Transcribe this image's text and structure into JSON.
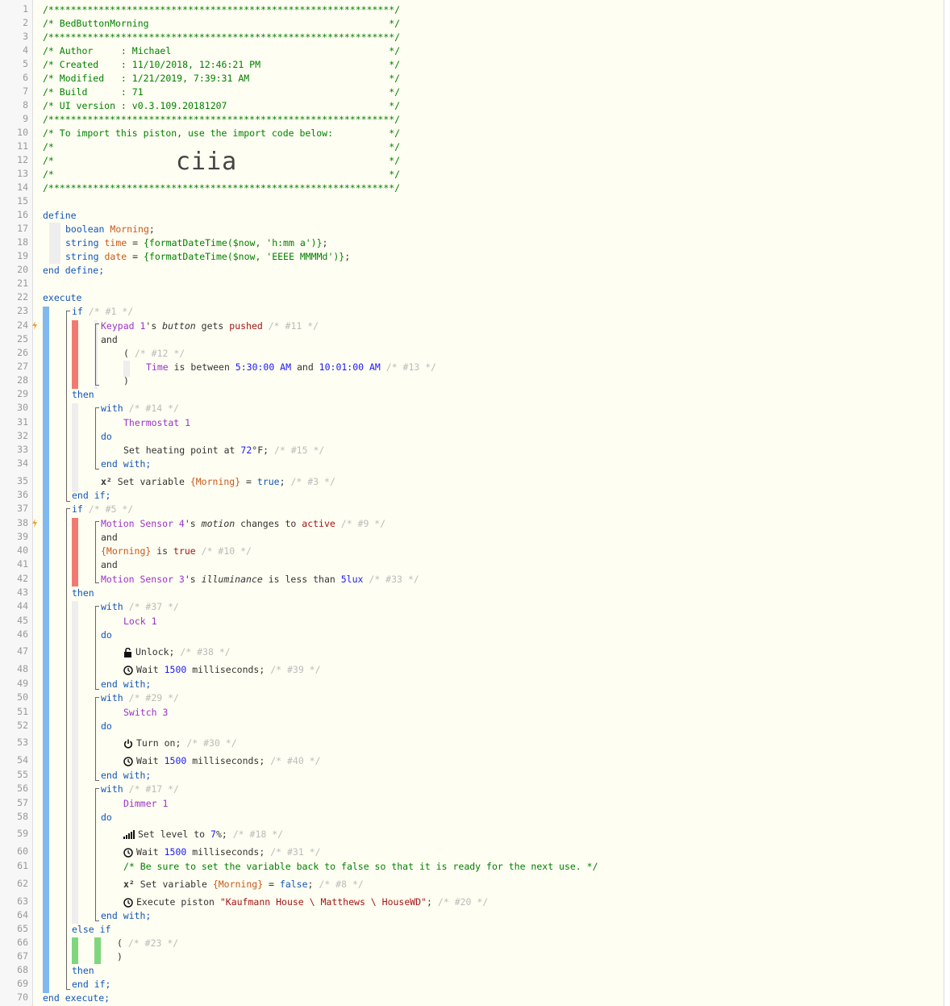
{
  "import_code": "ciia",
  "colors": {
    "gutter_bg": "#f7f7f7",
    "editor_bg": "#fffef2",
    "comment": "#008000",
    "keyword": "#1155bb",
    "variable": "#c65a1a",
    "device": "#9933cc",
    "if_condition_bar": "#f07a72",
    "else_if_condition_bar": "#7fd67f",
    "execute_bar": "#7fb9f0"
  },
  "icons": [
    "lightning-bolt-icon",
    "unlock-icon",
    "clock-icon",
    "power-icon",
    "signal-level-icon",
    "superscript-x2-icon"
  ],
  "line_numbers": [
    "1",
    "2",
    "3",
    "4",
    "5",
    "6",
    "7",
    "8",
    "9",
    "10",
    "11",
    "12",
    "13",
    "14",
    "15",
    "16",
    "17",
    "18",
    "19",
    "20",
    "21",
    "22",
    "23",
    "24",
    "25",
    "26",
    "27",
    "28",
    "29",
    "30",
    "31",
    "32",
    "33",
    "34",
    "35",
    "36",
    "37",
    "38",
    "39",
    "40",
    "41",
    "42",
    "43",
    "44",
    "45",
    "46",
    "47",
    "48",
    "49",
    "50",
    "51",
    "52",
    "53",
    "54",
    "55",
    "56",
    "57",
    "58",
    "59",
    "60",
    "61",
    "62",
    "63",
    "64",
    "65",
    "66",
    "67",
    "68",
    "69",
    "70"
  ],
  "header": [
    "/**************************************************************/",
    "/* BedButtonMorning                                           */",
    "/**************************************************************/",
    "/* Author     : Michael                                       */",
    "/* Created    : 11/10/2018, 12:46:21 PM                       */",
    "/* Modified   : 1/21/2019, 7:39:31 AM                         */",
    "/* Build      : 71                                            */",
    "/* UI version : v0.3.109.20181207                             */",
    "/**************************************************************/",
    "/* To import this piston, use the import code below:          */",
    "/*                                                            */",
    "/*                                                            */",
    "/*                                                            */",
    "/**************************************************************/"
  ],
  "define": {
    "kw": "define",
    "v1": {
      "type": "boolean",
      "name": "Morning",
      "rest": ";"
    },
    "v2": {
      "type": "string",
      "name": "time",
      "eq": " = ",
      "val": "{formatDateTime($now, 'h:mm a')}",
      "rest": ";"
    },
    "v3": {
      "type": "string",
      "name": "date",
      "eq": " = ",
      "val": "{formatDateTime($now, 'EEEE MMMMd')}",
      "rest": ";"
    },
    "end": "end define;"
  },
  "execute": {
    "kw": "execute",
    "if1": "if",
    "if1_c": "/* #1 */",
    "cond1": {
      "dev": "Keypad 1",
      "poss": "'s ",
      "attr": "button",
      "mid": " gets ",
      "val": "pushed",
      "c": "/* #11 */"
    },
    "and": "and",
    "grp": "(",
    "grp_c": "/* #12 */",
    "cond2": {
      "dev": "Time",
      "mid": " is between ",
      "t1": "5:30:00 AM",
      "and": " and ",
      "t2": "10:01:00 AM",
      "c": "/* #13 */"
    },
    "grp_close": ")",
    "then": "then",
    "with": "with",
    "with14_c": "/* #14 */",
    "thermostat": "Thermostat 1",
    "do": "do",
    "set_heat": {
      "pre": "Set heating point at ",
      "num": "72",
      "post": "°F;",
      "c": "/* #15 */"
    },
    "end_with": "end with;",
    "setvar1": {
      "pre": "Set variable ",
      "var": "{Morning}",
      "mid": " = ",
      "val": "true",
      "post": ";",
      "c": "/* #3 */"
    },
    "end_if": "end if;",
    "if5_c": "/* #5 */",
    "cond3": {
      "dev": "Motion Sensor 4",
      "poss": "'s ",
      "attr": "motion",
      "mid": " changes to ",
      "val": "active",
      "c": "/* #9 */"
    },
    "cond4": {
      "var": "{Morning}",
      "mid": " is ",
      "val": "true",
      "c": "/* #10 */"
    },
    "cond5": {
      "dev": "Motion Sensor 3",
      "poss": "'s ",
      "attr": "illuminance",
      "mid": " is less than ",
      "val": "5lux",
      "c": "/* #33 */"
    },
    "with37_c": "/* #37 */",
    "lock": "Lock 1",
    "unlock": {
      "text": "Unlock;",
      "c": "/* #38 */"
    },
    "wait39": {
      "pre": "Wait ",
      "num": "1500",
      "post": " milliseconds;",
      "c": "/* #39 */"
    },
    "with29_c": "/* #29 */",
    "switch": "Switch 3",
    "turnon": {
      "text": "Turn on;",
      "c": "/* #30 */"
    },
    "wait40": {
      "pre": "Wait ",
      "num": "1500",
      "post": " milliseconds;",
      "c": "/* #40 */"
    },
    "with17_c": "/* #17 */",
    "dimmer": "Dimmer 1",
    "setlevel": {
      "pre": "Set level to ",
      "num": "7",
      "post": "%;",
      "c": "/* #18 */"
    },
    "wait31": {
      "pre": "Wait ",
      "num": "1500",
      "post": " milliseconds;",
      "c": "/* #31 */"
    },
    "note": "/* Be sure to set the variable back to false so that it is ready for the next use. */",
    "setvar2": {
      "pre": "Set variable ",
      "var": "{Morning}",
      "mid": " = ",
      "val": "false",
      "post": ";",
      "c": "/* #8 */"
    },
    "exec_piston": {
      "pre": "Execute piston ",
      "val": "\"Kaufmann House \\ Matthews \\ HouseWD\"",
      "post": ";",
      "c": "/* #20 */"
    },
    "else_if": "else if",
    "grp23_c": "/* #23 */",
    "end_exec": "end execute;"
  }
}
